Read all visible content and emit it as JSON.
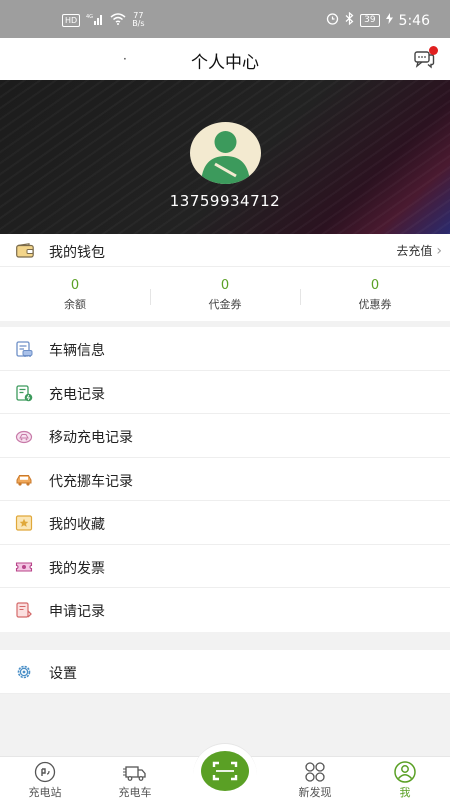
{
  "status_bar": {
    "hd": "HD",
    "signal": "4G",
    "speed_value": "77",
    "speed_unit": "B/s",
    "battery": "39",
    "time": "5:46"
  },
  "header": {
    "dot": "·",
    "title": "个人中心"
  },
  "profile": {
    "phone": "13759934712"
  },
  "wallet": {
    "title": "我的钱包",
    "recharge_label": "去充值",
    "stats": [
      {
        "value": "0",
        "label": "余额"
      },
      {
        "value": "0",
        "label": "代金券"
      },
      {
        "value": "0",
        "label": "优惠券"
      }
    ]
  },
  "menu": [
    {
      "label": "车辆信息",
      "icon": "vehicle-info-icon"
    },
    {
      "label": "充电记录",
      "icon": "charge-record-icon"
    },
    {
      "label": "移动充电记录",
      "icon": "mobile-charge-icon"
    },
    {
      "label": "代充挪车记录",
      "icon": "car-icon"
    },
    {
      "label": "我的收藏",
      "icon": "star-icon"
    },
    {
      "label": "我的发票",
      "icon": "invoice-icon"
    },
    {
      "label": "申请记录",
      "icon": "application-icon"
    }
  ],
  "settings": {
    "label": "设置",
    "icon": "gear-icon"
  },
  "tabs": [
    {
      "label": "充电站",
      "icon": "charging-station-icon"
    },
    {
      "label": "充电车",
      "icon": "charging-truck-icon"
    },
    {
      "label": "",
      "icon": "scan-icon"
    },
    {
      "label": "新发现",
      "icon": "discover-icon"
    },
    {
      "label": "我",
      "icon": "profile-icon",
      "active": true
    }
  ],
  "colors": {
    "accent": "#5aa025",
    "status_bar": "#9e9e9e",
    "badge": "#e02020"
  }
}
